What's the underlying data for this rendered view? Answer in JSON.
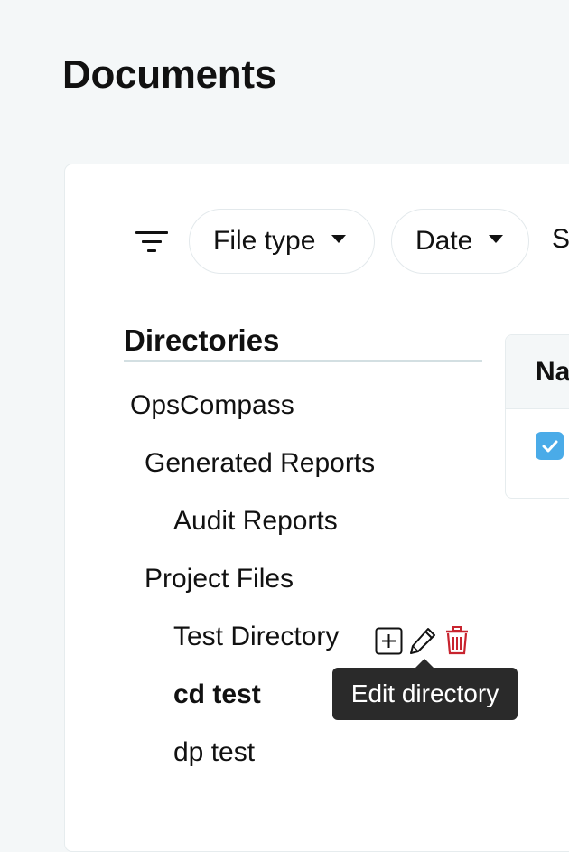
{
  "page": {
    "title": "Documents"
  },
  "filters": {
    "file_type_label": "File type",
    "date_label": "Date",
    "partial_label": "S"
  },
  "directories": {
    "heading": "Directories",
    "items": [
      {
        "label": "OpsCompass",
        "level": 0,
        "bold": false
      },
      {
        "label": "Generated Reports",
        "level": 1,
        "bold": false
      },
      {
        "label": "Audit Reports",
        "level": 2,
        "bold": false
      },
      {
        "label": "Project Files",
        "level": 1,
        "bold": false
      },
      {
        "label": "Test Directory",
        "level": 2,
        "bold": false,
        "hovered": true
      },
      {
        "label": "cd test",
        "level": 2,
        "bold": true
      },
      {
        "label": "dp test",
        "level": 2,
        "bold": false
      }
    ],
    "actions": {
      "add": "plus-square-icon",
      "edit": "pencil-icon",
      "delete": "trash-icon"
    },
    "tooltip": "Edit directory"
  },
  "table": {
    "header_partial": "Na",
    "rows": [
      {
        "checked": true
      }
    ]
  },
  "colors": {
    "background": "#f4f7f8",
    "checkbox": "#4aabe8",
    "delete": "#c8242f",
    "tooltip": "#2a2a2a"
  }
}
